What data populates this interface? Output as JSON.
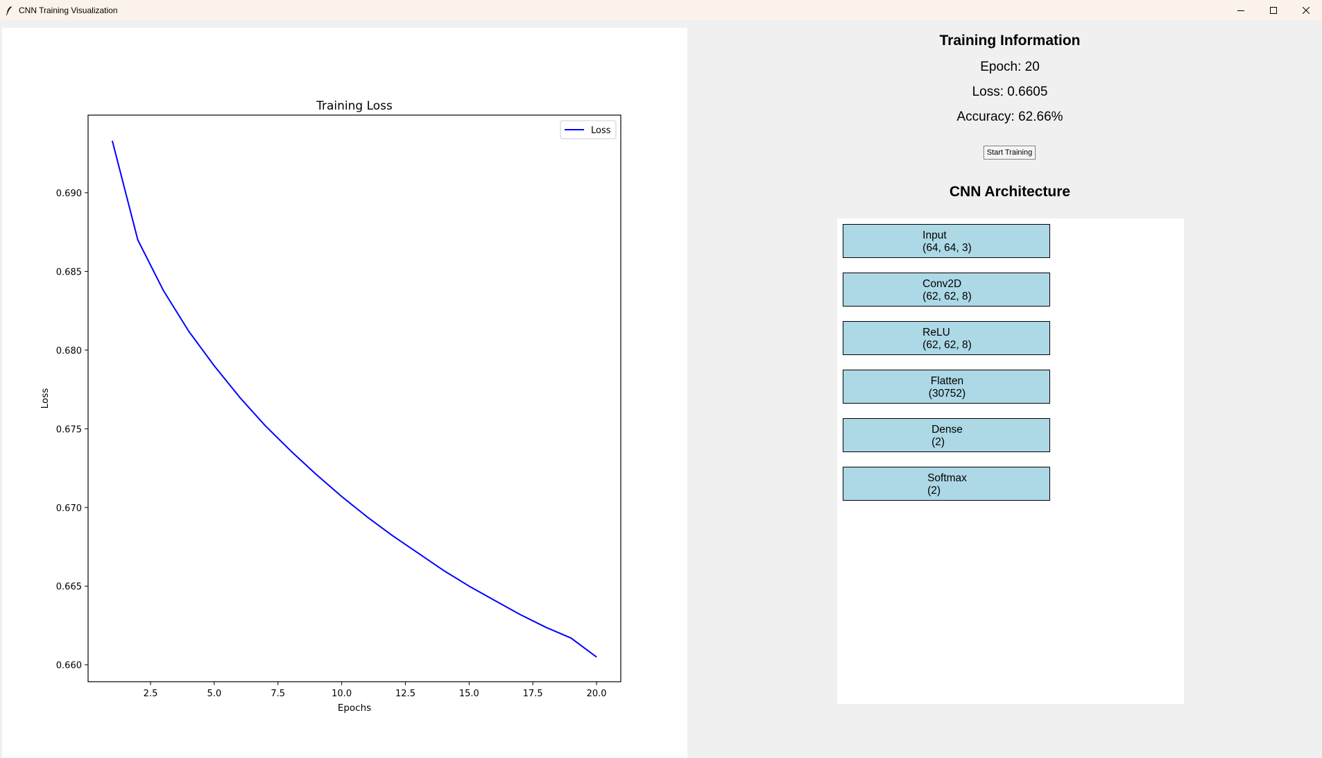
{
  "window": {
    "title": "CNN Training Visualization",
    "app_icon": "feather-icon",
    "controls": [
      "minimize-icon",
      "maximize-icon",
      "close-icon"
    ]
  },
  "training_info": {
    "title": "Training Information",
    "epoch": "Epoch: 20",
    "loss": "Loss: 0.6605",
    "accuracy": "Accuracy: 62.66%",
    "start_button": "Start Training"
  },
  "architecture": {
    "title": "CNN Architecture",
    "layers": [
      {
        "name": "Input",
        "shape": "(64, 64, 3)"
      },
      {
        "name": "Conv2D",
        "shape": "(62, 62, 8)"
      },
      {
        "name": "ReLU",
        "shape": "(62, 62, 8)"
      },
      {
        "name": "Flatten",
        "shape": "(30752)"
      },
      {
        "name": "Dense",
        "shape": "(2)"
      },
      {
        "name": "Softmax",
        "shape": "(2)"
      }
    ],
    "box_color": "#add8e6"
  },
  "chart_data": {
    "type": "line",
    "title": "Training Loss",
    "xlabel": "Epochs",
    "ylabel": "Loss",
    "xlim": [
      0.05,
      20.95
    ],
    "ylim": [
      0.65893,
      0.69493
    ],
    "xticks": [
      2.5,
      5.0,
      7.5,
      10.0,
      12.5,
      15.0,
      17.5,
      20.0
    ],
    "yticks": [
      0.66,
      0.665,
      0.67,
      0.675,
      0.68,
      0.685,
      0.69
    ],
    "legend": "top-right",
    "grid": false,
    "series": [
      {
        "name": "Loss",
        "color": "#0000ff",
        "x": [
          1,
          2,
          3,
          4,
          5,
          6,
          7,
          8,
          9,
          10,
          11,
          12,
          13,
          14,
          15,
          16,
          17,
          18,
          19,
          20
        ],
        "values": [
          0.6933,
          0.687,
          0.6838,
          0.6812,
          0.679,
          0.677,
          0.6752,
          0.6736,
          0.6721,
          0.6707,
          0.6694,
          0.6682,
          0.6671,
          0.666,
          0.665,
          0.6641,
          0.6632,
          0.6624,
          0.6617,
          0.6605
        ]
      }
    ]
  }
}
